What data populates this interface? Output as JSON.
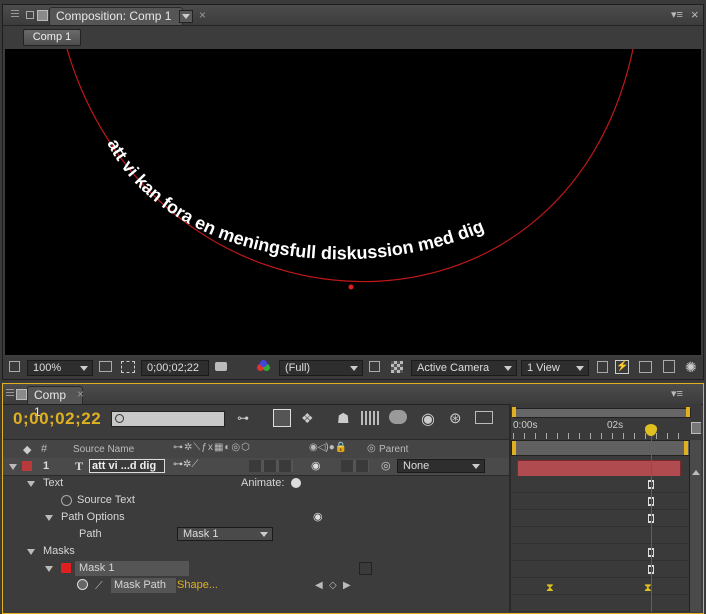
{
  "comp_panel": {
    "tab_label": "Composition: Comp 1",
    "breadcrumb": "Comp 1"
  },
  "viewer": {
    "path_text": "att vi kan fora en meningsfull diskussion med dig",
    "zoom": "100%",
    "timecode": "0;00;02;22",
    "resolution": "(Full)",
    "camera": "Active Camera",
    "views": "1 View"
  },
  "timeline": {
    "tab_label": "Comp 1",
    "current_time": "0;00;02;22",
    "search_placeholder": "",
    "columns": {
      "hash": "#",
      "source_name": "Source Name",
      "parent": "Parent"
    },
    "ruler": {
      "tick_0": "0:00s",
      "tick_2": "02s"
    },
    "layer": {
      "number": "1",
      "type_icon": "T",
      "name": "att vi ...d dig",
      "parent": "None",
      "label_color": "#b83a3a"
    },
    "properties": {
      "text": "Text",
      "animate": "Animate:",
      "source_text": "Source Text",
      "path_options": "Path Options",
      "path": "Path",
      "path_value": "Mask 1",
      "masks": "Masks",
      "mask1": "Mask 1",
      "mask_path": "Mask Path",
      "mask_path_value": "Shape..."
    },
    "colors": {
      "timecode": "#e0b020",
      "playhead": "#d03030",
      "mask_color": "#e02020",
      "layer_bar": "#b04b50"
    }
  }
}
